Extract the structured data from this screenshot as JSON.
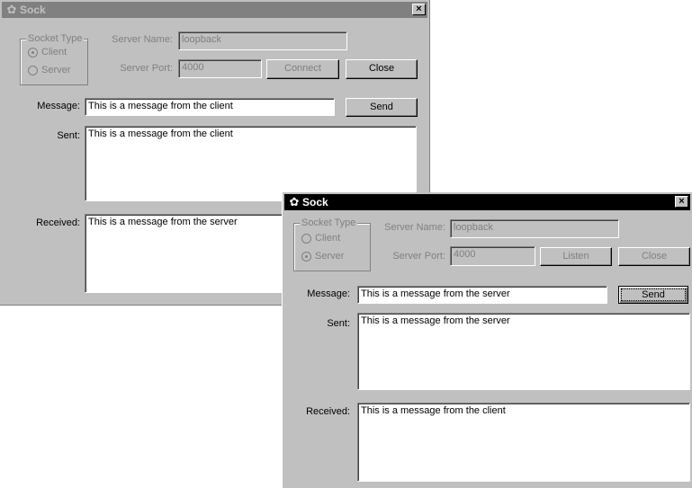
{
  "client_window": {
    "title": "Sock",
    "title_icon": "sock-app-icon",
    "close_glyph": "×",
    "socket_type_label": "Socket Type",
    "client_radio": {
      "label": "Client",
      "selected": true
    },
    "server_radio": {
      "label": "Server",
      "selected": false
    },
    "server_name_label": "Server Name:",
    "server_name_value": "loopback",
    "server_port_label": "Server Port:",
    "server_port_value": "4000",
    "connect_button": "Connect",
    "close_button": "Close",
    "message_label": "Message:",
    "message_value": "This is a message from the client",
    "send_button": "Send",
    "sent_label": "Sent:",
    "sent_value": "This is a message from the client",
    "received_label": "Received:",
    "received_value": "This is a message from the server"
  },
  "server_window": {
    "title": "Sock",
    "title_icon": "sock-app-icon",
    "close_glyph": "×",
    "socket_type_label": "Socket Type",
    "client_radio": {
      "label": "Client",
      "selected": false
    },
    "server_radio": {
      "label": "Server",
      "selected": true
    },
    "server_name_label": "Server Name:",
    "server_name_value": "loopback",
    "server_port_label": "Server Port:",
    "server_port_value": "4000",
    "listen_button": "Listen",
    "close_button": "Close",
    "message_label": "Message:",
    "message_value": "This is a message from the server",
    "send_button": "Send",
    "sent_label": "Sent:",
    "sent_value": "This is a message from the server",
    "received_label": "Received:",
    "received_value": "This is a message from the client"
  }
}
